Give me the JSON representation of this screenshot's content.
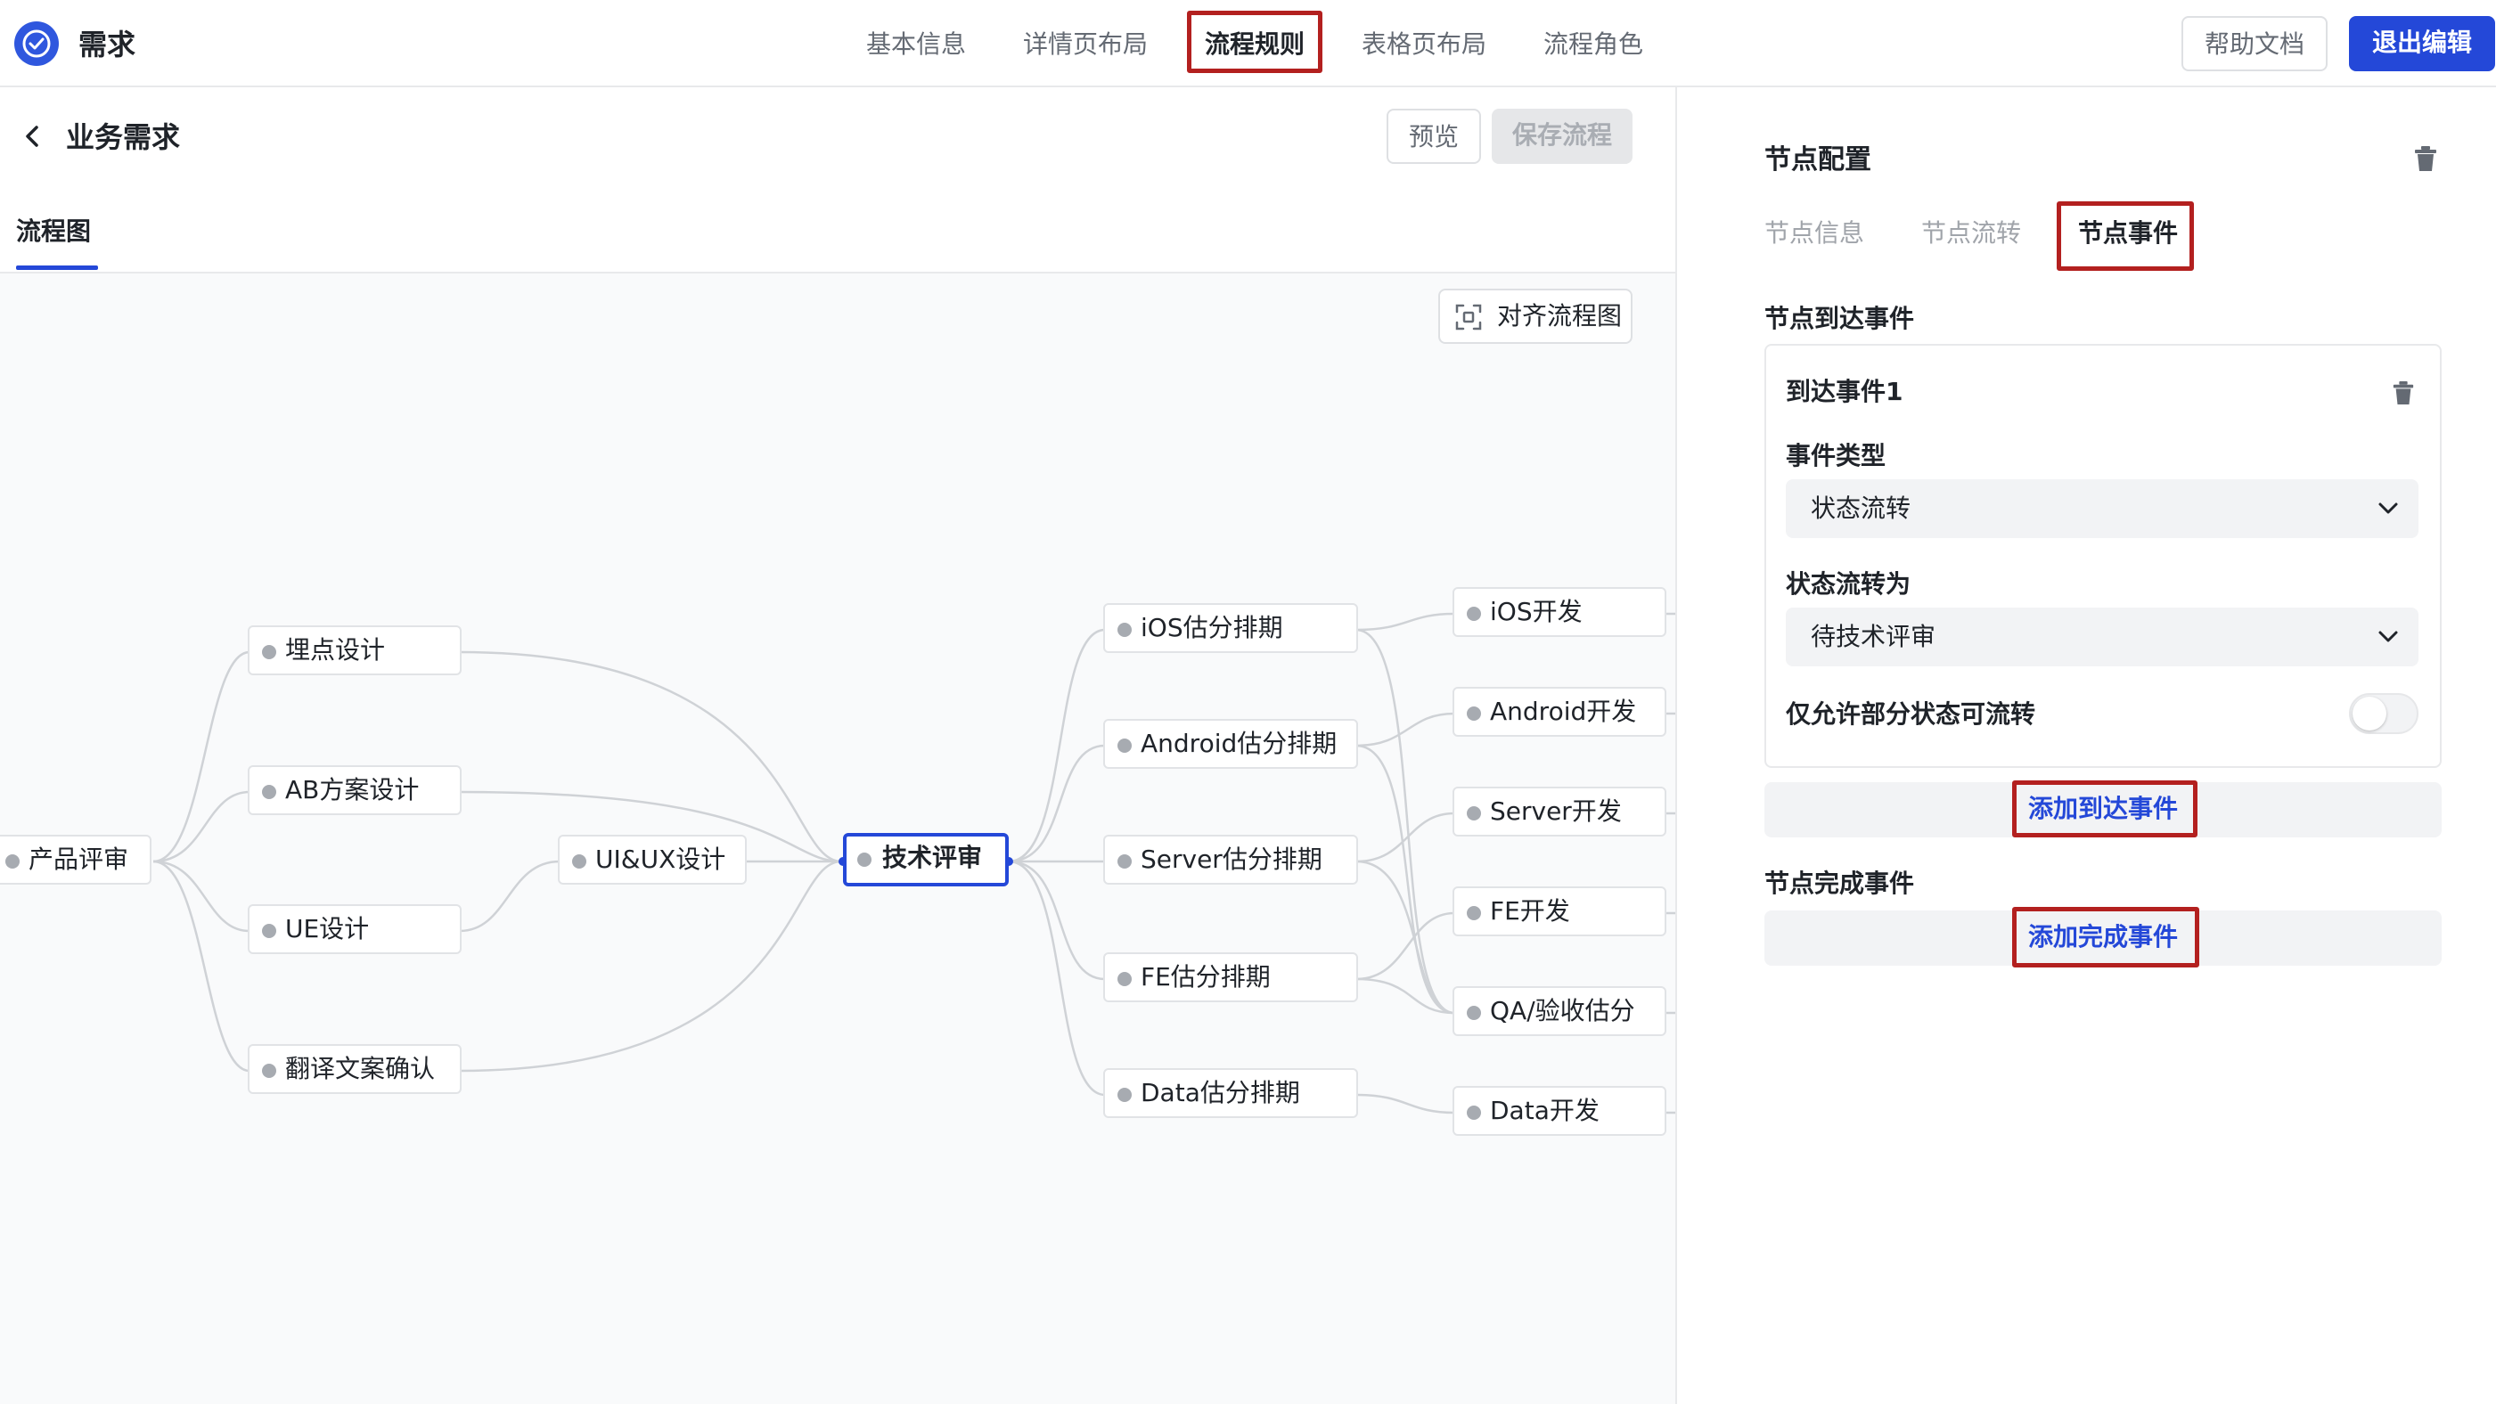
{
  "app": {
    "title": "需求",
    "accent": "#2448d8",
    "highlight": "#b3201f"
  },
  "nav": {
    "tabs": [
      {
        "label": "基本信息"
      },
      {
        "label": "详情页布局"
      },
      {
        "label": "流程规则",
        "active": true
      },
      {
        "label": "表格页布局"
      },
      {
        "label": "流程角色"
      }
    ],
    "help_label": "帮助文档",
    "exit_label": "退出编辑"
  },
  "page": {
    "title": "业务需求",
    "preview_label": "预览",
    "save_label": "保存流程",
    "subtab_label": "流程图",
    "align_label": "对齐流程图"
  },
  "flow": {
    "nodes": [
      {
        "id": "product",
        "label": "产品评审"
      },
      {
        "id": "track",
        "label": "埋点设计"
      },
      {
        "id": "ab",
        "label": "AB方案设计"
      },
      {
        "id": "ue",
        "label": "UE设计"
      },
      {
        "id": "translate",
        "label": "翻译文案确认"
      },
      {
        "id": "uiux",
        "label": "UI&UX设计"
      },
      {
        "id": "tech",
        "label": "技术评审",
        "selected": true
      },
      {
        "id": "ios_est",
        "label": "iOS估分排期"
      },
      {
        "id": "android_est",
        "label": "Android估分排期"
      },
      {
        "id": "server_est",
        "label": "Server估分排期"
      },
      {
        "id": "fe_est",
        "label": "FE估分排期"
      },
      {
        "id": "data_est",
        "label": "Data估分排期"
      },
      {
        "id": "ios_dev",
        "label": "iOS开发"
      },
      {
        "id": "android_dev",
        "label": "Android开发"
      },
      {
        "id": "server_dev",
        "label": "Server开发"
      },
      {
        "id": "fe_dev",
        "label": "FE开发"
      },
      {
        "id": "qa",
        "label": "QA/验收估分"
      },
      {
        "id": "data_dev",
        "label": "Data开发"
      }
    ]
  },
  "config": {
    "title": "节点配置",
    "tabs": [
      {
        "label": "节点信息"
      },
      {
        "label": "节点流转"
      },
      {
        "label": "节点事件",
        "active": true
      }
    ],
    "arrival_title": "节点到达事件",
    "event": {
      "title": "到达事件1",
      "type_label": "事件类型",
      "type_value": "状态流转",
      "status_label": "状态流转为",
      "status_value": "待技术评审",
      "partial_label": "仅允许部分状态可流转",
      "partial_enabled": false
    },
    "add_arrival_label": "添加到达事件",
    "complete_title": "节点完成事件",
    "add_complete_label": "添加完成事件"
  }
}
